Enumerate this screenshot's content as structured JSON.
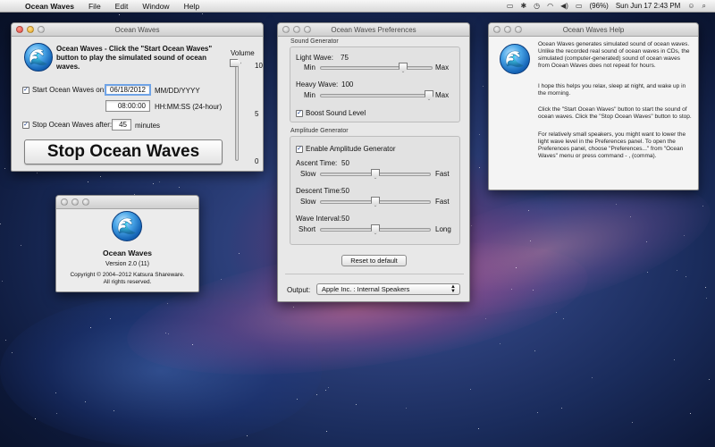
{
  "menubar": {
    "app_name": "Ocean Waves",
    "items": [
      "File",
      "Edit",
      "Window",
      "Help"
    ],
    "battery": "(96%)",
    "datetime": "Sun Jun 17  2:43 PM"
  },
  "main_window": {
    "title": "Ocean Waves",
    "instruction": "Ocean Waves - Click the \"Start Ocean Waves\" button to play the simulated sound of ocean waves.",
    "start_label": "Start Ocean Waves on:",
    "start_date": "06/18/2012",
    "date_format": "MM/DD/YYYY",
    "start_time": "08:00:00",
    "time_format": "HH:MM:SS (24-hour)",
    "stop_label": "Stop Ocean Waves after:",
    "stop_minutes": "45",
    "minutes_label": "minutes",
    "big_button": "Stop Ocean Waves",
    "volume_label": "Volume",
    "volume_ticks": [
      "10",
      "5",
      "0"
    ],
    "volume_value": 10,
    "start_checked": true,
    "stop_checked": true
  },
  "about_window": {
    "name": "Ocean Waves",
    "version": "Version 2.0 (11)",
    "copyright_line1": "Copyright © 2004–2012 Katsura Shareware.",
    "copyright_line2": "All rights reserved."
  },
  "prefs_window": {
    "title": "Ocean Waves Preferences",
    "sound_generator_label": "Sound Generator",
    "light_wave_label": "Light Wave:",
    "light_wave_value": "75",
    "heavy_wave_label": "Heavy Wave:",
    "heavy_wave_value": "100",
    "min_label": "Min",
    "max_label": "Max",
    "boost_label": "Boost Sound Level",
    "boost_checked": true,
    "amplitude_generator_label": "Amplitude Generator",
    "enable_amp_label": "Enable Amplitude Generator",
    "enable_amp_checked": true,
    "ascent_label": "Ascent Time:",
    "ascent_value": "50",
    "descent_label": "Descent Time:",
    "descent_value": "50",
    "interval_label": "Wave Interval:",
    "interval_value": "50",
    "slow_label": "Slow",
    "fast_label": "Fast",
    "short_label": "Short",
    "long_label": "Long",
    "reset_button": "Reset to default",
    "output_label": "Output:",
    "output_value": "Apple Inc. : Internal Speakers"
  },
  "help_window": {
    "title": "Ocean Waves Help",
    "p1": "Ocean Waves generates simulated sound of ocean waves. Unlike the recorded real sound of ocean waves in CDs, the simulated (computer-generated) sound of ocean waves from Ocean Waves does not repeat for hours.",
    "p2": "I hope this helps you relax, sleep at night, and wake up in the morning.",
    "p3": "Click the \"Start Ocean Waves\" button to start the sound of ocean waves. Click the \"Stop Ocean Waves\" button to stop.",
    "p4": "For relatively small speakers, you might want to lower the light wave level in the Preferences panel. To open the Preferences panel, choose \"Preferences...\" from \"Ocean Waves\" menu or press command - , (comma)."
  },
  "icons": {
    "wave_glyph": "🌊",
    "check_glyph": "✓"
  }
}
